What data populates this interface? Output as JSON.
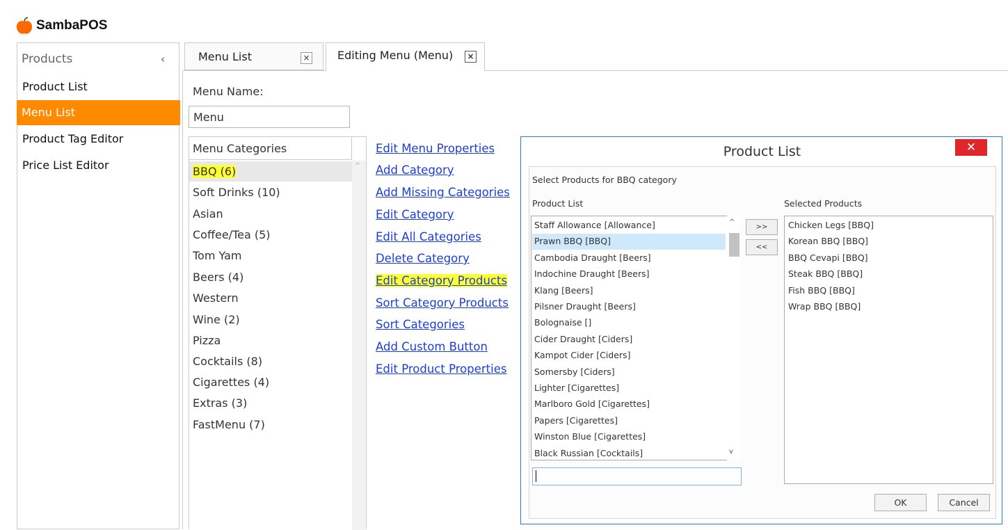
{
  "app": {
    "title": "SambaPOS"
  },
  "sidebar": {
    "title": "Products",
    "collapse_glyph": "‹",
    "items": [
      {
        "label": "Product List",
        "active": false
      },
      {
        "label": "Menu List",
        "active": true
      },
      {
        "label": "Product Tag Editor",
        "active": false
      },
      {
        "label": "Price List Editor",
        "active": false
      }
    ]
  },
  "tabs": [
    {
      "label": "Menu List",
      "close": "×",
      "active": false
    },
    {
      "label": "Editing Menu (Menu)",
      "close": "×",
      "active": true
    }
  ],
  "editor": {
    "menu_name_label": "Menu Name:",
    "menu_name_value": "Menu",
    "categories_header": "Menu Categories",
    "categories": [
      "BBQ (6)",
      "Soft Drinks (10)",
      "Asian",
      "Coffee/Tea (5)",
      "Tom Yam",
      "Beers (4)",
      "Western",
      "Wine (2)",
      "Pizza",
      "Cocktails (8)",
      "Cigarettes (4)",
      "Extras (3)",
      "FastMenu (7)"
    ],
    "selected_category": "BBQ (6)",
    "links": [
      "Edit Menu Properties",
      "Add Category",
      "Add Missing Categories",
      "Edit Category",
      "Edit All Categories",
      "Delete Category",
      "Edit Category Products",
      "Sort Category Products",
      "Sort Categories",
      "Add Custom Button",
      "Edit Product Properties"
    ],
    "highlighted_link": "Edit Category Products",
    "highlight_color": "#ffff33"
  },
  "dialog": {
    "title": "Product List",
    "close_glyph": "✕",
    "caption": "Select Products for BBQ category",
    "product_list_label": "Product List",
    "selected_label": "Selected Products",
    "products": [
      "Staff Allowance [Allowance]",
      "Prawn BBQ [BBQ]",
      "Cambodia Draught [Beers]",
      "Indochine Draught [Beers]",
      "Klang [Beers]",
      "Pilsner Draught [Beers]",
      "Bolognaise []",
      "Cider Draught [Ciders]",
      "Kampot Cider [Ciders]",
      "Somersby [Ciders]",
      "Lighter [Cigarettes]",
      "Marlboro Gold [Cigarettes]",
      "Papers [Cigarettes]",
      "Winston Blue [Cigarettes]",
      "Black Russian [Cocktails]"
    ],
    "selected_product_index": 1,
    "selected_products": [
      "Chicken Legs [BBQ]",
      "Korean BBQ [BBQ]",
      "BBQ Cevapi [BBQ]",
      "Steak BBQ [BBQ]",
      "Fish BBQ [BBQ]",
      "Wrap BBQ [BBQ]"
    ],
    "add_button": ">>",
    "remove_button": "<<",
    "search_value": "",
    "ok_label": "OK",
    "cancel_label": "Cancel"
  },
  "colors": {
    "accent": "#ff8a00",
    "link": "#1a3fd6",
    "dialog_border": "#2b7bd8",
    "close_red": "#e0262a"
  }
}
